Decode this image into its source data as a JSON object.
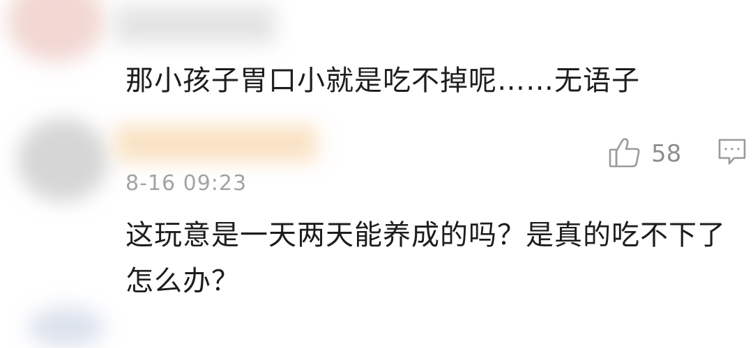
{
  "comments": [
    {
      "text": "那小孩子胃口小就是吃不掉呢……无语子"
    },
    {
      "like_count": "58",
      "timestamp": "8-16 09:23",
      "text": "这玩意是一天两天能养成的吗？是真的吃不下了怎么办？"
    }
  ],
  "icons": {
    "like": "thumbs-up-icon",
    "reply": "comment-bubble-icon"
  },
  "colors": {
    "text": "#1d1d1d",
    "meta": "#a3a3a3",
    "icon": "#9a9a9a"
  }
}
